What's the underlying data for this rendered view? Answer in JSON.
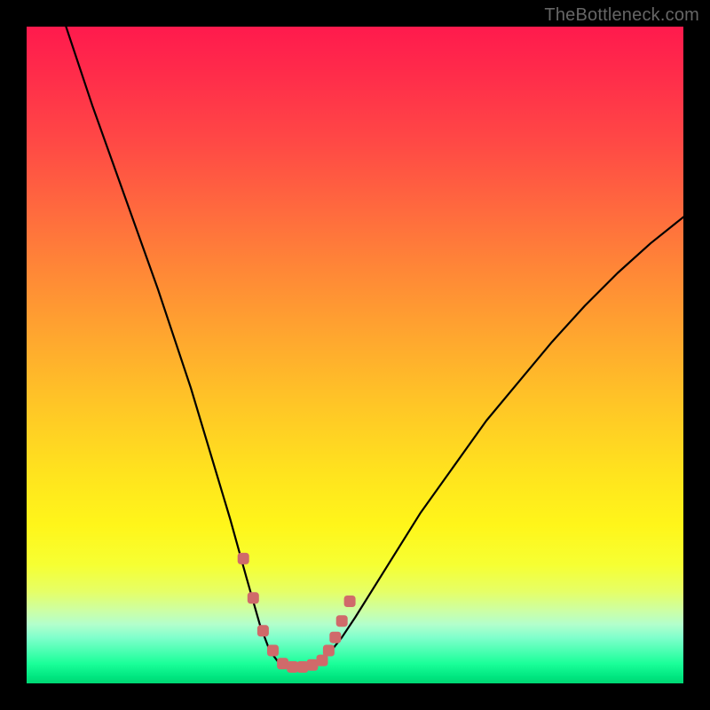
{
  "watermark": "TheBottleneck.com",
  "chart_data": {
    "type": "line",
    "title": "",
    "xlabel": "",
    "ylabel": "",
    "xlim": [
      0,
      100
    ],
    "ylim": [
      0,
      100
    ],
    "grid": false,
    "series": [
      {
        "name": "bottleneck-curve",
        "x": [
          6,
          10,
          15,
          20,
          25,
          28,
          31,
          33.5,
          35.5,
          37,
          38.5,
          40,
          42,
          44,
          46,
          48,
          50,
          55,
          60,
          65,
          70,
          75,
          80,
          85,
          90,
          95,
          100
        ],
        "values": [
          100,
          88,
          74,
          60,
          45,
          35,
          25,
          16,
          9,
          5,
          3,
          2.5,
          2.5,
          3,
          4.5,
          7,
          10,
          18,
          26,
          33,
          40,
          46,
          52,
          57.5,
          62.5,
          67,
          71
        ]
      }
    ],
    "markers": {
      "name": "valley-points",
      "color": "#d06a6a",
      "x": [
        33,
        34.5,
        36,
        37.5,
        39,
        40.5,
        42,
        43.5,
        45,
        46,
        47,
        48,
        49.2
      ],
      "values": [
        19,
        13,
        8,
        5,
        3,
        2.5,
        2.5,
        2.8,
        3.5,
        5,
        7,
        9.5,
        12.5
      ]
    },
    "gradient_stops": [
      {
        "pos": 0,
        "color": "#ff1a4d"
      },
      {
        "pos": 50,
        "color": "#ffb028"
      },
      {
        "pos": 75,
        "color": "#fff020"
      },
      {
        "pos": 95,
        "color": "#40ffb0"
      },
      {
        "pos": 100,
        "color": "#00d673"
      }
    ]
  }
}
